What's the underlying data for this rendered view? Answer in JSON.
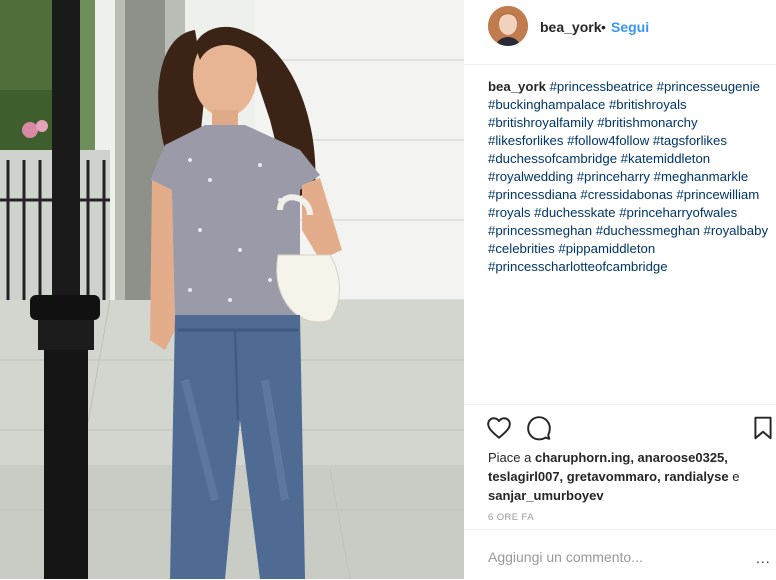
{
  "post": {
    "author": "bea_york",
    "separator": "•",
    "follow_label": "Segui",
    "caption_user": "bea_york",
    "hashtags": "#princessbeatrice #princesseugenie #buckinghampalace #britishroyals #britishroyalfamily #britishmonarchy #likesforlikes #follow4follow #tagsforlikes #duchessofcambridge #katemiddleton #royalwedding #princeharry #meghanmarkle #princessdiana #cressidabonas #princewilliam #royals #duchesskate #princeharryofwales #princessmeghan #duchessmeghan #royalbaby #celebrities #pippamiddleton #princesscharlotteofcambridge"
  },
  "likes": {
    "prefix": "Piace a",
    "users": "charuphorn.ing, anaroose0325, teslagirl007, gretavommaro, randialyse",
    "conj": "e",
    "last": "sanjar_umurboyev"
  },
  "time": "6 ORE FA",
  "comment": {
    "placeholder": "Aggiungi un commento...",
    "more": "..."
  },
  "icons": [
    "heart-icon",
    "comment-icon",
    "bookmark-icon"
  ]
}
